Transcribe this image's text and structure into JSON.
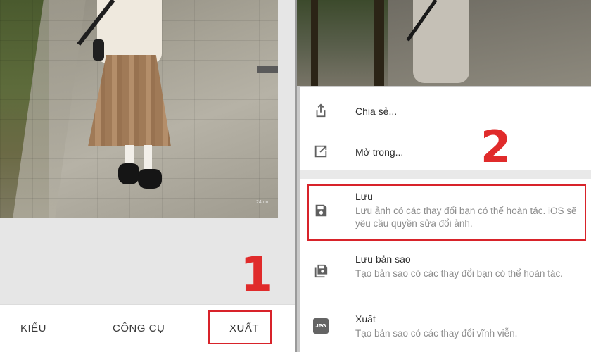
{
  "left": {
    "bottom_tabs": [
      {
        "label": "KIỂU"
      },
      {
        "label": "CÔNG CỤ"
      },
      {
        "label": "XUẤT"
      }
    ],
    "step_number": "1",
    "photo_watermark": "24mm"
  },
  "right": {
    "step_number": "2",
    "menu": {
      "share": {
        "label": "Chia sẻ...",
        "icon": "share-icon"
      },
      "open_in": {
        "label": "Mở trong...",
        "icon": "open-external-icon"
      },
      "save": {
        "label": "Lưu",
        "description": "Lưu ảnh có các thay đổi bạn có thể hoàn tác. iOS sẽ yêu cầu quyền sửa đổi ảnh.",
        "icon": "save-icon"
      },
      "save_copy": {
        "label": "Lưu bản sao",
        "description": "Tạo bản sao có các thay đổi bạn có thể hoàn tác.",
        "icon": "save-copy-icon"
      },
      "export": {
        "label": "Xuất",
        "description": "Tạo bản sao có các thay đổi vĩnh viễn.",
        "icon_text": "JPG"
      }
    }
  },
  "colors": {
    "highlight": "#d8232a",
    "step_number": "#e02b2b",
    "icon": "#5f5f5f",
    "menu_label": "#2e2e2e",
    "menu_desc": "#8c8c8c"
  }
}
